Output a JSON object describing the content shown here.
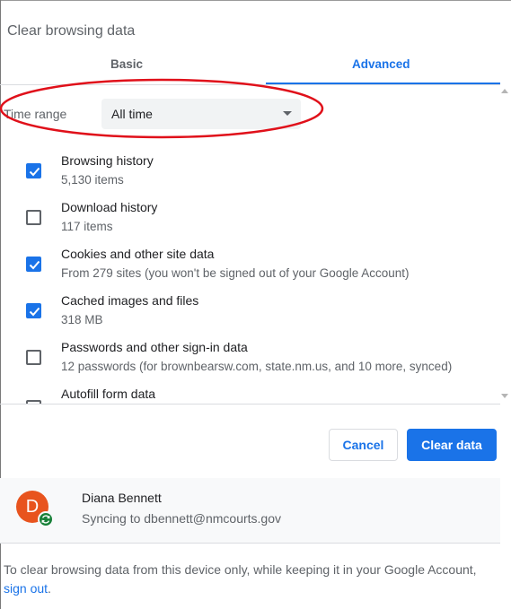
{
  "dialog": {
    "title": "Clear browsing data"
  },
  "tabs": [
    {
      "label": "Basic",
      "active": false
    },
    {
      "label": "Advanced",
      "active": true
    }
  ],
  "time_range": {
    "label": "Time range",
    "value": "All time"
  },
  "options": [
    {
      "label": "Browsing history",
      "sub": "5,130 items",
      "checked": true
    },
    {
      "label": "Download history",
      "sub": "117 items",
      "checked": false
    },
    {
      "label": "Cookies and other site data",
      "sub": "From 279 sites (you won't be signed out of your Google Account)",
      "checked": true
    },
    {
      "label": "Cached images and files",
      "sub": "318 MB",
      "checked": true
    },
    {
      "label": "Passwords and other sign-in data",
      "sub": "12 passwords (for brownbearsw.com, state.nm.us, and 10 more, synced)",
      "checked": false
    },
    {
      "label": "Autofill form data",
      "sub": "",
      "checked": false
    }
  ],
  "buttons": {
    "cancel": "Cancel",
    "clear": "Clear data"
  },
  "account": {
    "initial": "D",
    "name": "Diana Bennett",
    "sync_status": "Syncing to dbennett@nmcourts.gov"
  },
  "footer": {
    "text": "To clear browsing data from this device only, while keeping it in your Google Account, ",
    "link": "sign out",
    "end": "."
  },
  "colors": {
    "accent": "#1a73e8",
    "highlight": "#e0101a",
    "avatar": "#e8541e",
    "sync": "#188038"
  }
}
